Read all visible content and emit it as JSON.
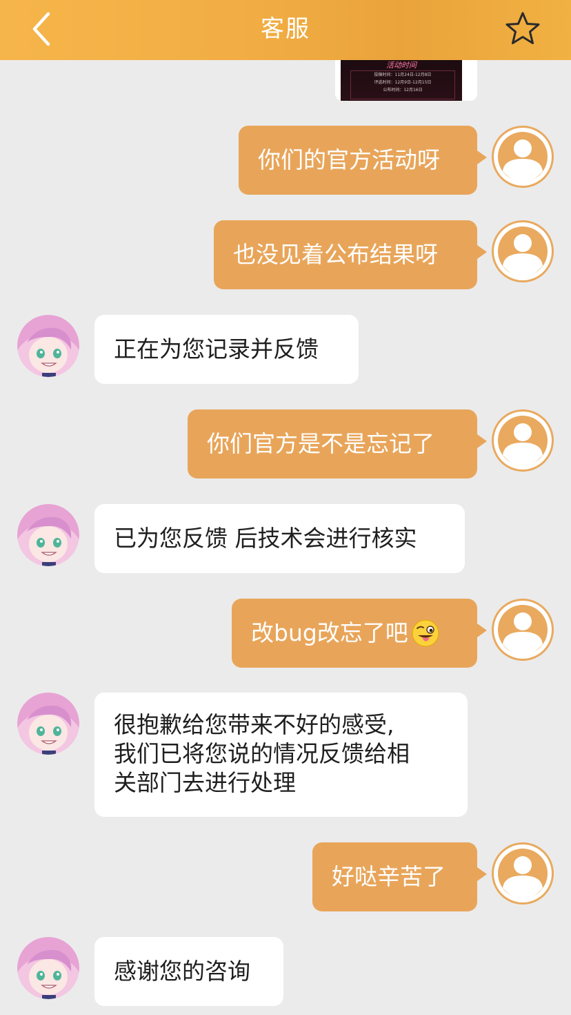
{
  "header": {
    "title": "客服"
  },
  "icons": {
    "back": "chevron-left-icon",
    "favorite": "star-outline-icon",
    "user": "user-silhouette-icon",
    "emoji": "winking-tongue-emoji"
  },
  "shared_image": {
    "title": "活动时间",
    "lines": [
      "投稿时间：11月24日-12月8日",
      "评选时间：12月9日-12月15日",
      "公布时间：12月16日"
    ]
  },
  "messages": [
    {
      "from": "me",
      "text": "你们的官方活动呀"
    },
    {
      "from": "me",
      "text": "也没见着公布结果呀"
    },
    {
      "from": "agent",
      "text": "正在为您记录并反馈"
    },
    {
      "from": "me",
      "text": "你们官方是不是忘记了"
    },
    {
      "from": "agent",
      "text": "已为您反馈 后技术会进行核实"
    },
    {
      "from": "me",
      "text": "改bug改忘了吧"
    },
    {
      "from": "agent",
      "lines": [
        "很抱歉给您带来不好的感受,",
        "我们已将您说的情况反馈给相",
        "关部门去进行处理"
      ]
    },
    {
      "from": "me",
      "text": "好哒辛苦了"
    },
    {
      "from": "agent",
      "text": "感谢您的咨询"
    }
  ],
  "colors": {
    "header": "#f1ad43",
    "my_bubble": "#e8a55a",
    "agent_bubble": "#ffffff",
    "background": "#ebebeb"
  }
}
